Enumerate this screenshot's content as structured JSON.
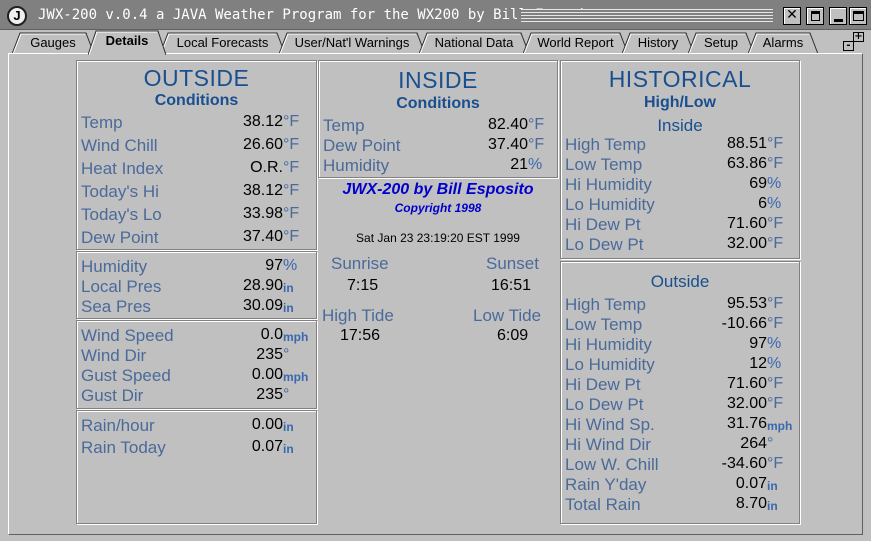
{
  "window": {
    "title": "JWX-200 v.0.4    a JAVA Weather Program for the WX200 by Bill Esposito",
    "icon_letter": "J",
    "controls": {
      "close": "✕",
      "menu": "menu-icon",
      "minimize": "minimize-icon",
      "maximize": "maximize-icon"
    }
  },
  "tabs": [
    {
      "label": "Gauges"
    },
    {
      "label": "Details"
    },
    {
      "label": "Local Forecasts"
    },
    {
      "label": "User/Nat'l Warnings"
    },
    {
      "label": "National Data"
    },
    {
      "label": "World Report"
    },
    {
      "label": "History"
    },
    {
      "label": "Setup"
    },
    {
      "label": "Alarms"
    }
  ],
  "active_tab": "Details",
  "tab_scroll": {
    "minus": "-",
    "plus": "+"
  },
  "outside": {
    "title": "OUTSIDE",
    "subtitle": "Conditions",
    "conditions": [
      {
        "label": "Temp",
        "value": "38.12",
        "unit": "°F"
      },
      {
        "label": "Wind Chill",
        "value": "26.60",
        "unit": "°F"
      },
      {
        "label": "Heat Index",
        "value": "O.R.",
        "unit": "°F"
      },
      {
        "label": "Today's Hi",
        "value": "38.12",
        "unit": "°F"
      },
      {
        "label": "Today's Lo",
        "value": "33.98",
        "unit": "°F"
      },
      {
        "label": "Dew Point",
        "value": "37.40",
        "unit": "°F"
      }
    ],
    "humidity_pressure": [
      {
        "label": "Humidity",
        "value": "97",
        "unit": "%"
      },
      {
        "label": "Local Pres",
        "value": "28.90",
        "unit": "in"
      },
      {
        "label": "Sea Pres",
        "value": "30.09",
        "unit": "in"
      }
    ],
    "wind": [
      {
        "label": "Wind Speed",
        "value": "0.0",
        "unit": "mph"
      },
      {
        "label": "Wind Dir",
        "value": "235",
        "unit": "°"
      },
      {
        "label": "Gust Speed",
        "value": "0.00",
        "unit": "mph"
      },
      {
        "label": "Gust Dir",
        "value": "235",
        "unit": "°"
      }
    ],
    "rain": [
      {
        "label": "Rain/hour",
        "value": "0.00",
        "unit": "in"
      },
      {
        "label": "Rain Today",
        "value": "0.07",
        "unit": "in"
      }
    ]
  },
  "inside": {
    "title": "INSIDE",
    "subtitle": "Conditions",
    "conditions": [
      {
        "label": "Temp",
        "value": "82.40",
        "unit": "°F"
      },
      {
        "label": "Dew Point",
        "value": "37.40",
        "unit": "°F"
      },
      {
        "label": "Humidity",
        "value": "21",
        "unit": "%"
      }
    ]
  },
  "credits": {
    "name": "JWX-200 by Bill Esposito",
    "copyright": "Copyright 1998",
    "datetime": "Sat Jan 23 23:19:20 EST 1999"
  },
  "sun_tide": {
    "sunrise_label": "Sunrise",
    "sunrise": "7:15",
    "sunset_label": "Sunset",
    "sunset": "16:51",
    "high_tide_label": "High Tide",
    "high_tide": "17:56",
    "low_tide_label": "Low Tide",
    "low_tide": "6:09"
  },
  "historical": {
    "title": "HISTORICAL",
    "subtitle": "High/Low",
    "inside_label": "Inside",
    "inside": [
      {
        "label": "High Temp",
        "value": "88.51",
        "unit": "°F"
      },
      {
        "label": "Low Temp",
        "value": "63.86",
        "unit": "°F"
      },
      {
        "label": "Hi Humidity",
        "value": "69",
        "unit": "%"
      },
      {
        "label": "Lo Humidity",
        "value": "6",
        "unit": "%"
      },
      {
        "label": "Hi Dew Pt",
        "value": "71.60",
        "unit": "°F"
      },
      {
        "label": "Lo Dew Pt",
        "value": "32.00",
        "unit": "°F"
      }
    ],
    "outside_label": "Outside",
    "outside": [
      {
        "label": "High Temp",
        "value": "95.53",
        "unit": "°F"
      },
      {
        "label": "Low Temp",
        "value": "-10.66",
        "unit": "°F"
      },
      {
        "label": "Hi Humidity",
        "value": "97",
        "unit": "%"
      },
      {
        "label": "Lo Humidity",
        "value": "12",
        "unit": "%"
      },
      {
        "label": "Hi Dew Pt",
        "value": "71.60",
        "unit": "°F"
      },
      {
        "label": "Lo Dew Pt",
        "value": "32.00",
        "unit": "°F"
      },
      {
        "label": "Hi Wind Sp.",
        "value": "31.76",
        "unit": "mph"
      },
      {
        "label": "Hi Wind Dir",
        "value": "264",
        "unit": "°"
      },
      {
        "label": "Low W. Chill",
        "value": "-34.60",
        "unit": "°F"
      },
      {
        "label": "Rain Y'day",
        "value": "0.07",
        "unit": "in"
      },
      {
        "label": "Total Rain",
        "value": "8.70",
        "unit": "in"
      }
    ]
  }
}
